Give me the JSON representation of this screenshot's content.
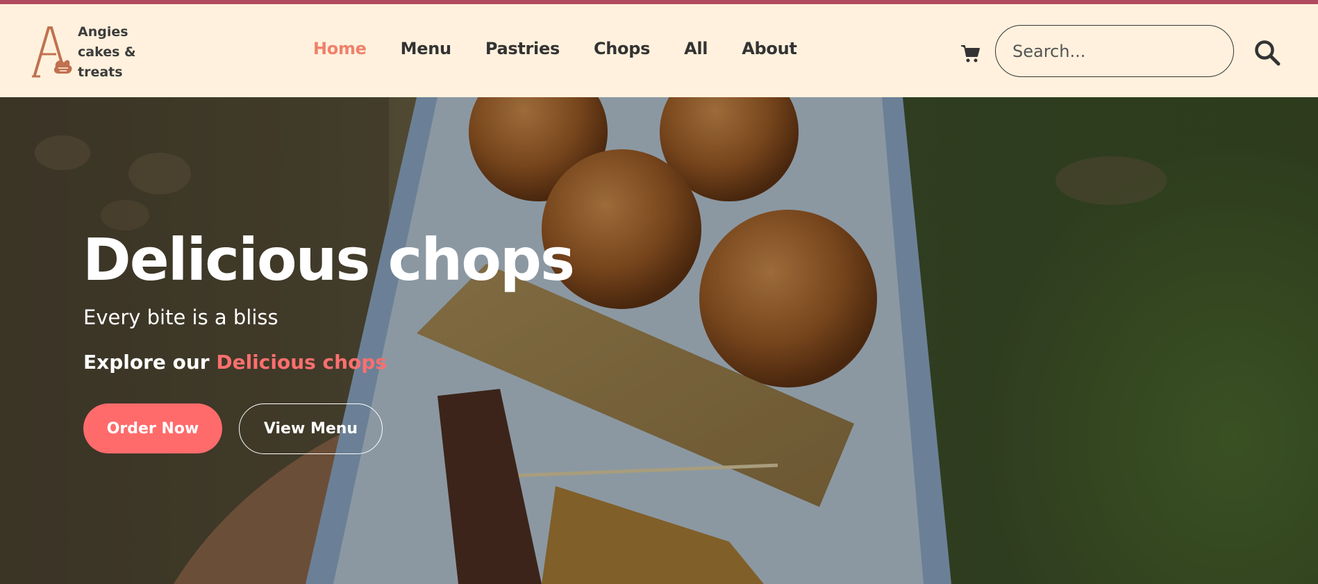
{
  "brand": {
    "name_line1": "Angies",
    "name_line2": "cakes &",
    "name_line3": "treats",
    "logo_color": "#c0714f"
  },
  "nav": {
    "items": [
      {
        "label": "Home",
        "active": true
      },
      {
        "label": "Menu",
        "active": false
      },
      {
        "label": "Pastries",
        "active": false
      },
      {
        "label": "Chops",
        "active": false
      },
      {
        "label": "All",
        "active": false
      },
      {
        "label": "About",
        "active": false
      }
    ],
    "active_color": "#f0816b"
  },
  "header": {
    "cart_icon": "shopping-cart-icon",
    "search_placeholder": "Search...",
    "search_icon": "magnifier-icon",
    "background": "#fff1dd"
  },
  "hero": {
    "title": "Delicious chops",
    "subtitle": "Every bite is a bliss",
    "explore_prefix": "Explore our ",
    "explore_highlight": "Delicious chops",
    "order_button": "Order Now",
    "menu_button": "View Menu",
    "accent_color": "#ff6b6b"
  }
}
